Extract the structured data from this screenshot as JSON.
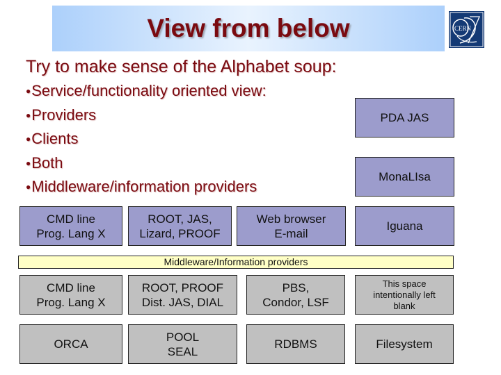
{
  "header": {
    "title": "View from below",
    "logo_label": "CERN"
  },
  "subtitle": "Try to make sense of the Alphabet soup:",
  "bullets": [
    "Service/functionality oriented view:",
    "Providers",
    "Clients",
    "Both",
    "Middleware/information providers"
  ],
  "right_column": {
    "pda_jas": "PDA JAS",
    "monalisa": "MonaLIsa",
    "iguana": "Iguana"
  },
  "client_row": [
    "CMD line\nProg. Lang X",
    "ROOT, JAS,\nLizard, PROOF",
    "Web browser\nE-mail"
  ],
  "middleware_bar": "Middleware/Information providers",
  "provider_row_1": [
    "CMD line\nProg. Lang X",
    "ROOT, PROOF\nDist. JAS, DIAL",
    "PBS,\nCondor, LSF",
    "This space\nintentionally left\nblank"
  ],
  "provider_row_2": [
    "ORCA",
    "POOL\nSEAL",
    "RDBMS",
    "Filesystem"
  ],
  "colors": {
    "title": "#7a0a10",
    "client_box": "#9c9ccc",
    "provider_box": "#c0c0c0",
    "middleware_bar": "#ffffc6",
    "logo_bg": "#143a75"
  }
}
